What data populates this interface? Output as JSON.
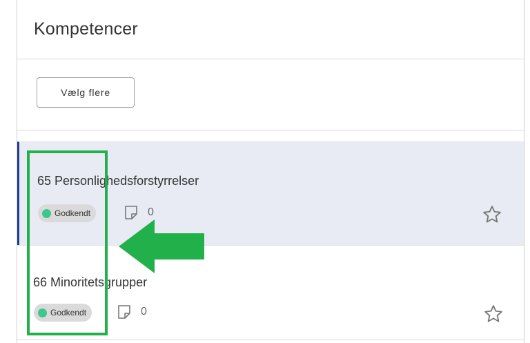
{
  "header": {
    "title": "Kompetencer"
  },
  "toolbar": {
    "choose_more_label": "Vælg flere"
  },
  "items": [
    {
      "title": "65 Personlighedsforstyrrelser",
      "status": "Godkendt",
      "notes_count": "0",
      "selected": true
    },
    {
      "title": "66 Minoritetsgrupper",
      "status": "Godkendt",
      "notes_count": "0",
      "selected": false
    }
  ],
  "icons": {
    "note": "note-icon",
    "star": "star-icon",
    "status_dot": "status-dot"
  },
  "colors": {
    "status_dot": "#3cc78c",
    "selected_bg": "#e8ebf3",
    "selected_accent": "#1f3a8a",
    "annotation_green": "#22b04a"
  }
}
